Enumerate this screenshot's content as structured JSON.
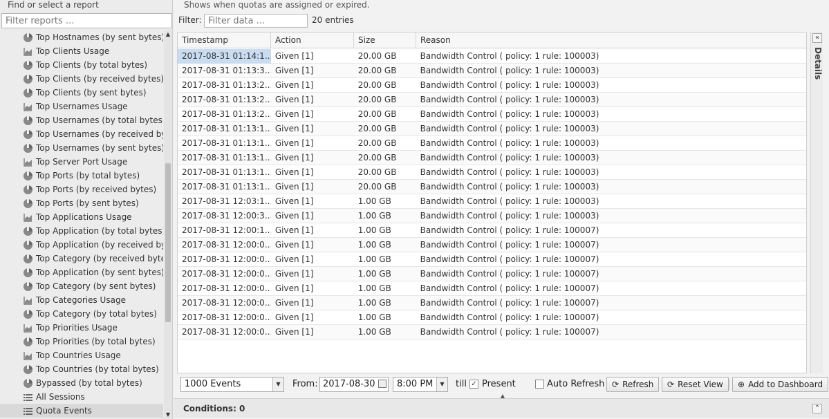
{
  "left": {
    "title": "Find or select a report",
    "filter_placeholder": "Filter reports ...",
    "items": [
      {
        "label": "Top Hostnames (by sent bytes)",
        "icon": "pie-chart-icon"
      },
      {
        "label": "Top Clients Usage",
        "icon": "area-chart-icon"
      },
      {
        "label": "Top Clients (by total bytes)",
        "icon": "pie-chart-icon"
      },
      {
        "label": "Top Clients (by received bytes)",
        "icon": "pie-chart-icon"
      },
      {
        "label": "Top Clients (by sent bytes)",
        "icon": "pie-chart-icon"
      },
      {
        "label": "Top Usernames Usage",
        "icon": "area-chart-icon"
      },
      {
        "label": "Top Usernames (by total bytes)",
        "icon": "pie-chart-icon"
      },
      {
        "label": "Top Usernames (by received bytes)",
        "icon": "pie-chart-icon"
      },
      {
        "label": "Top Usernames (by sent bytes)",
        "icon": "pie-chart-icon"
      },
      {
        "label": "Top Server Port Usage",
        "icon": "area-chart-icon"
      },
      {
        "label": "Top Ports (by total bytes)",
        "icon": "pie-chart-icon"
      },
      {
        "label": "Top Ports (by received bytes)",
        "icon": "pie-chart-icon"
      },
      {
        "label": "Top Ports (by sent bytes)",
        "icon": "pie-chart-icon"
      },
      {
        "label": "Top Applications Usage",
        "icon": "area-chart-icon"
      },
      {
        "label": "Top Application (by total bytes)",
        "icon": "pie-chart-icon"
      },
      {
        "label": "Top Application (by received bytes)",
        "icon": "pie-chart-icon"
      },
      {
        "label": "Top Category (by received bytes)",
        "icon": "pie-chart-icon"
      },
      {
        "label": "Top Application (by sent bytes)",
        "icon": "pie-chart-icon"
      },
      {
        "label": "Top Category (by sent bytes)",
        "icon": "pie-chart-icon"
      },
      {
        "label": "Top Categories Usage",
        "icon": "area-chart-icon"
      },
      {
        "label": "Top Category (by total bytes)",
        "icon": "pie-chart-icon"
      },
      {
        "label": "Top Priorities Usage",
        "icon": "area-chart-icon"
      },
      {
        "label": "Top Priorities (by total bytes)",
        "icon": "pie-chart-icon"
      },
      {
        "label": "Top Countries Usage",
        "icon": "area-chart-icon"
      },
      {
        "label": "Top Countries (by total bytes)",
        "icon": "pie-chart-icon"
      },
      {
        "label": "Bypassed (by total bytes)",
        "icon": "pie-chart-icon"
      },
      {
        "label": "All Sessions",
        "icon": "list-icon"
      },
      {
        "label": "Quota Events",
        "icon": "list-icon",
        "selected": true
      }
    ]
  },
  "main": {
    "description": "Shows when quotas are assigned or expired.",
    "filter_label": "Filter:",
    "filter_placeholder": "Filter data ...",
    "entries": "20 entries",
    "columns": [
      "Timestamp",
      "Action",
      "Size",
      "Reason"
    ],
    "rows": [
      [
        "2017-08-31 01:14:1...",
        "Given [1]",
        "20.00 GB",
        "Bandwidth Control ( policy: 1 rule: 100003)"
      ],
      [
        "2017-08-31 01:13:3...",
        "Given [1]",
        "20.00 GB",
        "Bandwidth Control ( policy: 1 rule: 100003)"
      ],
      [
        "2017-08-31 01:13:2...",
        "Given [1]",
        "20.00 GB",
        "Bandwidth Control ( policy: 1 rule: 100003)"
      ],
      [
        "2017-08-31 01:13:2...",
        "Given [1]",
        "20.00 GB",
        "Bandwidth Control ( policy: 1 rule: 100003)"
      ],
      [
        "2017-08-31 01:13:2...",
        "Given [1]",
        "20.00 GB",
        "Bandwidth Control ( policy: 1 rule: 100003)"
      ],
      [
        "2017-08-31 01:13:1...",
        "Given [1]",
        "20.00 GB",
        "Bandwidth Control ( policy: 1 rule: 100003)"
      ],
      [
        "2017-08-31 01:13:1...",
        "Given [1]",
        "20.00 GB",
        "Bandwidth Control ( policy: 1 rule: 100003)"
      ],
      [
        "2017-08-31 01:13:1...",
        "Given [1]",
        "20.00 GB",
        "Bandwidth Control ( policy: 1 rule: 100003)"
      ],
      [
        "2017-08-31 01:13:1...",
        "Given [1]",
        "20.00 GB",
        "Bandwidth Control ( policy: 1 rule: 100003)"
      ],
      [
        "2017-08-31 01:13:1...",
        "Given [1]",
        "20.00 GB",
        "Bandwidth Control ( policy: 1 rule: 100003)"
      ],
      [
        "2017-08-31 12:03:1...",
        "Given [1]",
        "1.00 GB",
        "Bandwidth Control ( policy: 1 rule: 100003)"
      ],
      [
        "2017-08-31 12:00:3...",
        "Given [1]",
        "1.00 GB",
        "Bandwidth Control ( policy: 1 rule: 100003)"
      ],
      [
        "2017-08-31 12:00:1...",
        "Given [1]",
        "1.00 GB",
        "Bandwidth Control ( policy: 1 rule: 100007)"
      ],
      [
        "2017-08-31 12:00:0...",
        "Given [1]",
        "1.00 GB",
        "Bandwidth Control ( policy: 1 rule: 100007)"
      ],
      [
        "2017-08-31 12:00:0...",
        "Given [1]",
        "1.00 GB",
        "Bandwidth Control ( policy: 1 rule: 100007)"
      ],
      [
        "2017-08-31 12:00:0...",
        "Given [1]",
        "1.00 GB",
        "Bandwidth Control ( policy: 1 rule: 100007)"
      ],
      [
        "2017-08-31 12:00:0...",
        "Given [1]",
        "1.00 GB",
        "Bandwidth Control ( policy: 1 rule: 100007)"
      ],
      [
        "2017-08-31 12:00:0...",
        "Given [1]",
        "1.00 GB",
        "Bandwidth Control ( policy: 1 rule: 100007)"
      ],
      [
        "2017-08-31 12:00:0...",
        "Given [1]",
        "1.00 GB",
        "Bandwidth Control ( policy: 1 rule: 100007)"
      ],
      [
        "2017-08-31 12:00:0...",
        "Given [1]",
        "1.00 GB",
        "Bandwidth Control ( policy: 1 rule: 100007)"
      ]
    ],
    "details_label": "Details"
  },
  "toolbar": {
    "events_select": "1000 Events",
    "from_label": "From:",
    "from_date": "2017-08-30",
    "from_time": "8:00 PM",
    "till_label": "till",
    "present_label": "Present",
    "present_checked": true,
    "auto_refresh_label": "Auto Refresh",
    "auto_refresh_checked": false,
    "refresh_label": "Refresh",
    "reset_view_label": "Reset View",
    "add_dashboard_label": "Add to Dashboard"
  },
  "conditions": {
    "text": "Conditions: 0"
  },
  "colors": {
    "selection": "#c9dcf1",
    "panel_bg": "#ececec"
  }
}
